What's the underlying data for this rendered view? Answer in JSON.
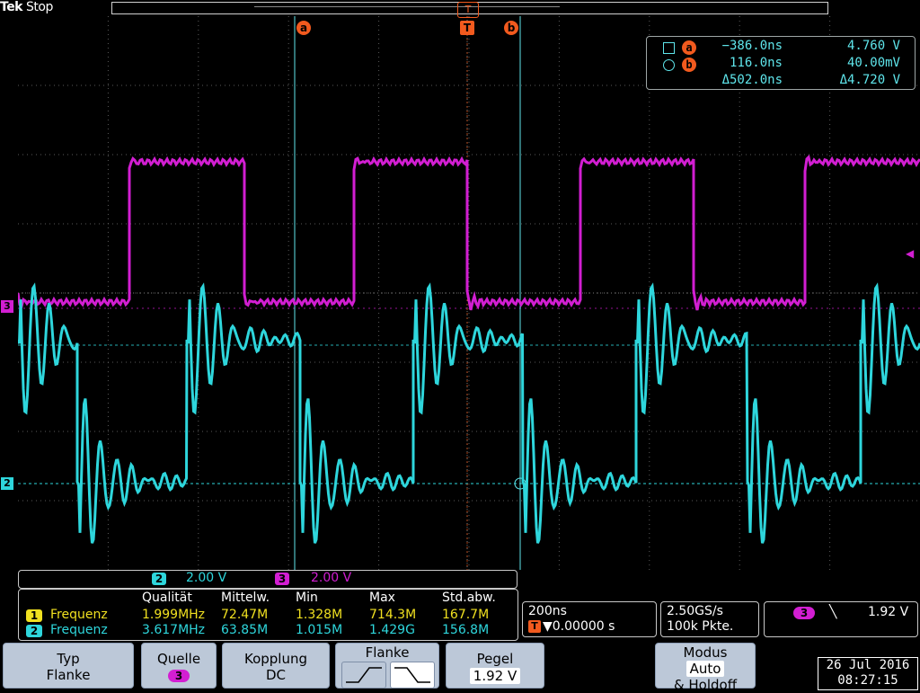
{
  "header": {
    "brand": "Tek",
    "status": "Stop",
    "trigger_marker_label": "T"
  },
  "cursors": {
    "a_label": "a",
    "b_label": "b",
    "readout": {
      "a_time": "−386.0ns",
      "a_value": "4.760 V",
      "b_time": "116.0ns",
      "b_value": "40.00mV",
      "delta_time": "Δ502.0ns",
      "delta_value": "Δ4.720 V"
    }
  },
  "channels": {
    "ch2": {
      "number": "2",
      "scale": "2.00 V",
      "color": "#2ed6dc"
    },
    "ch3": {
      "number": "3",
      "scale": "2.00 V",
      "color": "#d21ed2"
    },
    "ch1": {
      "number": "1",
      "color": "#f0e020"
    }
  },
  "measurements": {
    "headers": [
      "Qualität",
      "Mittelw.",
      "Min",
      "Max",
      "Std.abw."
    ],
    "rows": [
      {
        "ch": "1",
        "name": "Frequenz",
        "values": [
          "1.999MHz",
          "72.47M",
          "1.328M",
          "714.3M",
          "167.7M"
        ],
        "color": "#f0e020"
      },
      {
        "ch": "2",
        "name": "Frequenz",
        "values": [
          "3.617MHz",
          "63.85M",
          "1.015M",
          "1.429G",
          "156.8M"
        ],
        "color": "#2ed6dc"
      }
    ]
  },
  "timebase": {
    "scale": "200ns",
    "trigger_pos": "▼0.00000 s",
    "trigger_pos_prefix": "T",
    "sample_rate": "2.50GS/s",
    "record_length": "100k Pkte."
  },
  "trigger": {
    "source": "3",
    "slope_glyph": "╲",
    "level": "1.92 V"
  },
  "softkeys": [
    {
      "label": "Typ",
      "value": "Flanke"
    },
    {
      "label": "Quelle",
      "value": "3"
    },
    {
      "label": "Kopplung",
      "value": "DC"
    },
    {
      "label": "Flanke",
      "value": ""
    },
    {
      "label": "Pegel",
      "value": "1.92 V"
    },
    {
      "label": "Modus",
      "value": "Auto",
      "extra": "& Holdoff"
    }
  ],
  "datetime": {
    "date": "26 Jul  2016",
    "time": "08:27:15"
  },
  "colors": {
    "accent_cursor": "#f25a1e",
    "readout_text": "#5fe6ec",
    "grid": "#6a6a6a",
    "softkey_bg": "#bcc8d8"
  }
}
